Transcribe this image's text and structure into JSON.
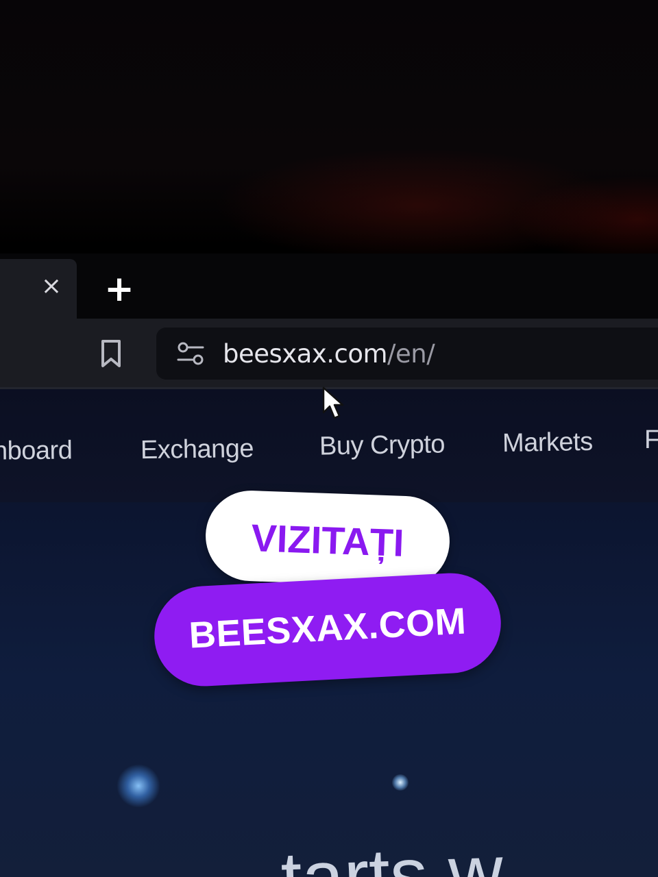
{
  "browser": {
    "tab": {
      "close_glyph": "×",
      "close_icon": "close-icon"
    },
    "new_tab": {
      "glyph": "+",
      "icon": "plus-icon"
    },
    "toolbar": {
      "bookmark_icon": "bookmark-icon",
      "site_info_icon": "tune-icon"
    },
    "address_bar": {
      "host": "beesxax.com",
      "path": "/en/"
    }
  },
  "site": {
    "nav": {
      "items": [
        {
          "label": "nboard"
        },
        {
          "label": "Exchange"
        },
        {
          "label": "Buy Crypto"
        },
        {
          "label": "Markets"
        },
        {
          "label": "F."
        }
      ]
    },
    "hero": {
      "partial_text": "tarts w"
    }
  },
  "overlay": {
    "visit_label": "VIZITAȚI",
    "domain_label": "BEESXAX.COM",
    "colors": {
      "accent": "#8f1cf2",
      "pill_light": "#ffffff"
    }
  }
}
